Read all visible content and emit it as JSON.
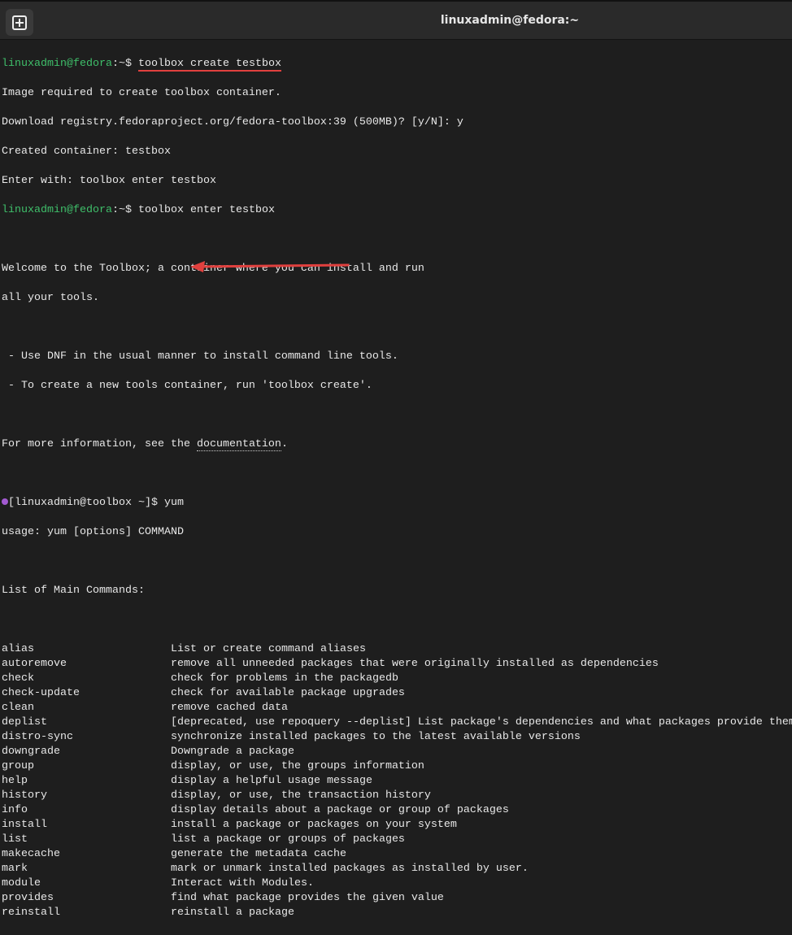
{
  "window": {
    "title": "linuxadmin@fedora:~",
    "new_tab_icon": "new-tab-icon"
  },
  "session": {
    "prompt1_user": "linuxadmin@fedora",
    "prompt1_rest": ":~$ ",
    "cmd1": "toolbox create testbox",
    "out1": "Image required to create toolbox container.",
    "out2": "Download registry.fedoraproject.org/fedora-toolbox:39 (500MB)? [y/N]: y",
    "out3": "Created container: testbox",
    "out4": "Enter with: toolbox enter testbox",
    "cmd2": "toolbox enter testbox",
    "welcome1": "Welcome to the Toolbox; a container where you can install and run",
    "welcome2": "all your tools.",
    "bullet1": " - Use DNF in the usual manner to install command line tools.",
    "bullet2": " - To create a new tools container, run 'toolbox create'.",
    "info_prefix": "For more information, see the ",
    "info_link": "documentation",
    "info_suffix": ".",
    "prompt2": "[linuxadmin@toolbox ~]$ ",
    "cmd3": "yum",
    "usage": "usage: yum [options] COMMAND",
    "list_header": "List of Main Commands:"
  },
  "commands": [
    {
      "name": "alias",
      "desc": "List or create command aliases"
    },
    {
      "name": "autoremove",
      "desc": "remove all unneeded packages that were originally installed as dependencies"
    },
    {
      "name": "check",
      "desc": "check for problems in the packagedb"
    },
    {
      "name": "check-update",
      "desc": "check for available package upgrades"
    },
    {
      "name": "clean",
      "desc": "remove cached data"
    },
    {
      "name": "deplist",
      "desc": "[deprecated, use repoquery --deplist] List package's dependencies and what packages provide them"
    },
    {
      "name": "distro-sync",
      "desc": "synchronize installed packages to the latest available versions"
    },
    {
      "name": "downgrade",
      "desc": "Downgrade a package"
    },
    {
      "name": "group",
      "desc": "display, or use, the groups information"
    },
    {
      "name": "help",
      "desc": "display a helpful usage message"
    },
    {
      "name": "history",
      "desc": "display, or use, the transaction history"
    },
    {
      "name": "info",
      "desc": "display details about a package or group of packages"
    },
    {
      "name": "install",
      "desc": "install a package or packages on your system"
    },
    {
      "name": "list",
      "desc": "list a package or groups of packages"
    },
    {
      "name": "makecache",
      "desc": "generate the metadata cache"
    },
    {
      "name": "mark",
      "desc": "mark or unmark installed packages as installed by user."
    },
    {
      "name": "module",
      "desc": "Interact with Modules."
    },
    {
      "name": "provides",
      "desc": "find what package provides the given value"
    },
    {
      "name": "reinstall",
      "desc": "reinstall a package"
    }
  ],
  "colors": {
    "prompt_green": "#3fbf6a",
    "annotation_red": "#e0403e",
    "toolbox_dot": "#a35ad1"
  }
}
